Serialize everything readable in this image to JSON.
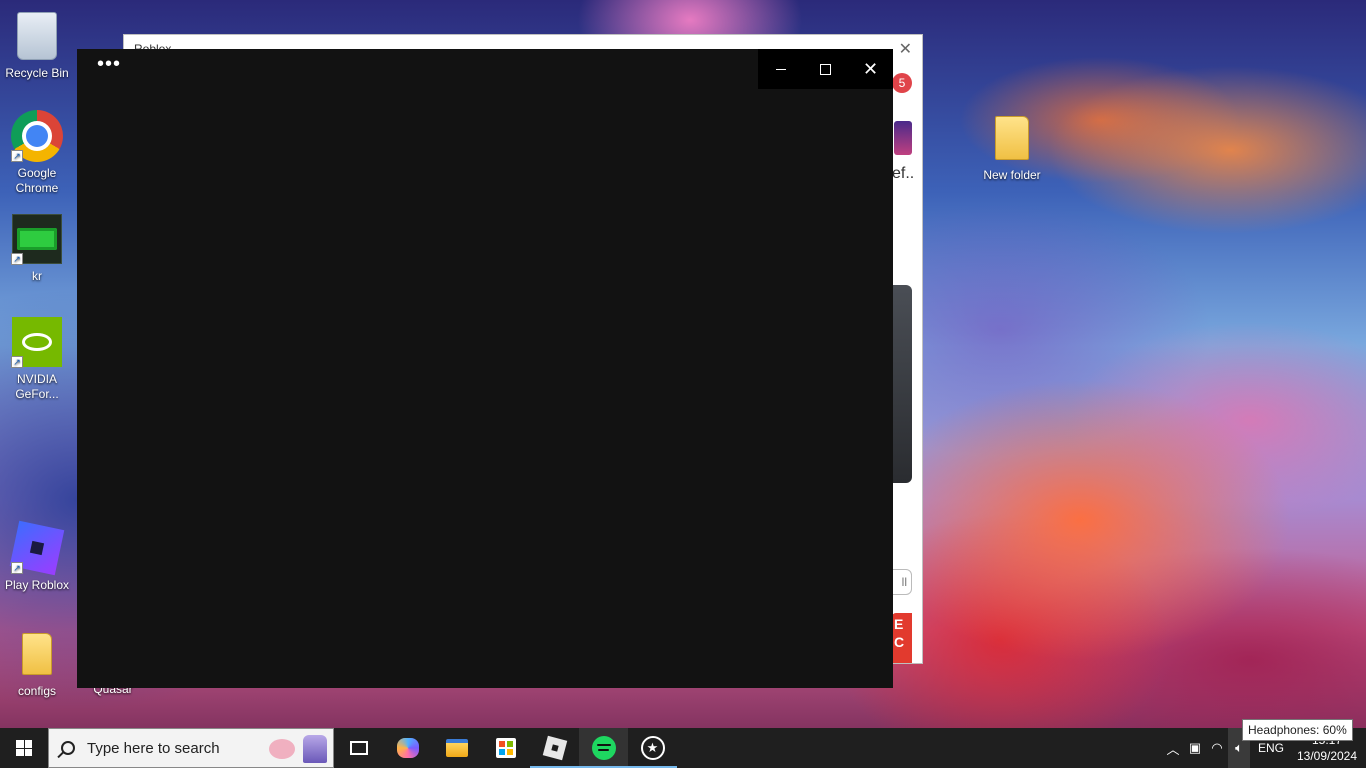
{
  "desktop": {
    "icons": [
      {
        "label": "Recycle Bin",
        "icon": "recycle-bin-icon"
      },
      {
        "label": "Google Chrome",
        "icon": "chrome-icon"
      },
      {
        "label": "kr",
        "icon": "memory-chip-icon"
      },
      {
        "label": "NVIDIA GeFor...",
        "icon": "nvidia-icon"
      },
      {
        "label": "Play Roblox",
        "icon": "roblox-icon"
      },
      {
        "label": "configs",
        "icon": "folder-icon"
      },
      {
        "label": "Quasar",
        "icon": "app-icon"
      },
      {
        "label": "New folder",
        "icon": "folder-icon"
      }
    ]
  },
  "background_window": {
    "title": "Roblox",
    "notification_count": "5",
    "partial_text": "ef..",
    "partial_button": "ll",
    "partial_thumb_text": "E C"
  },
  "main_window": {
    "more_label": "•••",
    "close_label": "✕"
  },
  "taskbar": {
    "search_placeholder": "Type here to search",
    "apps": [
      "task-view",
      "copilot",
      "file-explorer",
      "microsoft-store",
      "roblox",
      "spotify",
      "game-launcher"
    ],
    "active_app": "spotify",
    "language": "ENG",
    "time": "15:17",
    "date": "13/09/2024"
  },
  "tooltip": {
    "text": "Headphones: 60%"
  },
  "colors": {
    "window_bg": "#121212",
    "taskbar_bg": "#1f1f1f",
    "accent": "#76b9ed"
  }
}
